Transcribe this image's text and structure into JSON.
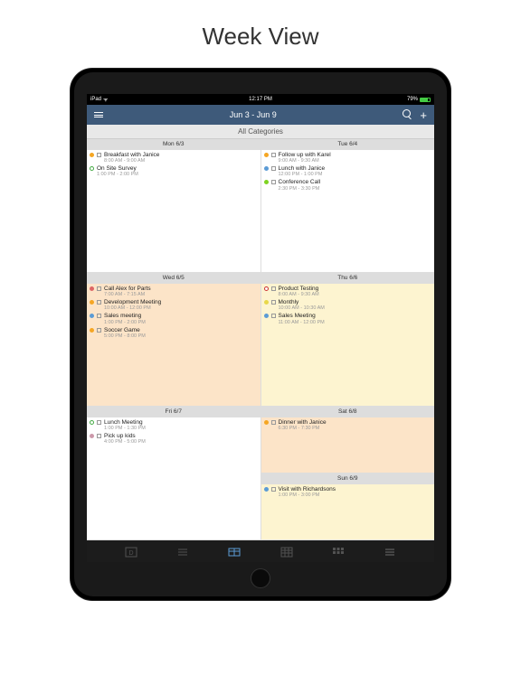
{
  "title": "Week View",
  "statusbar": {
    "device": "iPad",
    "time": "12:17 PM",
    "battery": "79%"
  },
  "nav": {
    "title": "Jun 3 - Jun 9"
  },
  "categories": "All Categories",
  "days": {
    "mon": {
      "label": "Mon 6/3",
      "bg": "white",
      "events": [
        {
          "dot": "#f5a623",
          "title": "Breakfast with Janice",
          "time": "8:00 AM - 9:00 AM",
          "chk": true
        },
        {
          "dot": "#4a4",
          "title": "On Site Survey",
          "time": "1:00 PM - 2:00 PM",
          "chk": false,
          "ring": true
        }
      ]
    },
    "tue": {
      "label": "Tue 6/4",
      "bg": "white",
      "events": [
        {
          "dot": "#f5a623",
          "title": "Follow up with Karel",
          "time": "9:00 AM - 9:30 AM",
          "chk": true
        },
        {
          "dot": "#5b9bd5",
          "title": "Lunch with Janice",
          "time": "12:00 PM - 1:00 PM",
          "chk": true
        },
        {
          "dot": "#7ed321",
          "title": "Conference Call",
          "time": "2:30 PM - 3:30 PM",
          "chk": true
        }
      ]
    },
    "wed": {
      "label": "Wed 6/5",
      "bg": "orange",
      "events": [
        {
          "dot": "#d66",
          "title": "Call Alex for Parts",
          "time": "7:00 AM - 7:15 AM",
          "chk": true
        },
        {
          "dot": "#f5a623",
          "title": "Development Meeting",
          "time": "10:00 AM - 12:00 PM",
          "chk": true
        },
        {
          "dot": "#5b9bd5",
          "title": "Sales meeting",
          "time": "1:00 PM - 2:00 PM",
          "chk": true
        },
        {
          "dot": "#f5a623",
          "title": "Soccer Game",
          "time": "5:00 PM - 8:00 PM",
          "chk": true
        }
      ]
    },
    "thu": {
      "label": "Thu 6/6",
      "bg": "yellow",
      "events": [
        {
          "dot": "#c33",
          "title": "Product Testing",
          "time": "8:00 AM - 9:30 AM",
          "chk": true,
          "ring": true
        },
        {
          "dot": "#e8d84a",
          "title": "Monthly",
          "time": "10:00 AM - 10:30 AM",
          "chk": true
        },
        {
          "dot": "#5b9bd5",
          "title": "Sales Meeting",
          "time": "11:00 AM - 12:00 PM",
          "chk": true
        }
      ]
    },
    "fri": {
      "label": "Fri 6/7",
      "bg": "white",
      "events": [
        {
          "dot": "#4a4",
          "title": "Lunch Meeting",
          "time": "1:00 PM - 1:30 PM",
          "chk": true,
          "ring": true
        },
        {
          "dot": "#c9a",
          "title": "Pick up kids",
          "time": "4:00 PM - 5:00 PM",
          "chk": true
        }
      ]
    },
    "sat": {
      "label": "Sat 6/8",
      "bg": "orange",
      "events": [
        {
          "dot": "#f5a623",
          "title": "Dinner with Janice",
          "time": "6:30 PM - 7:30 PM",
          "chk": true
        }
      ]
    },
    "sun": {
      "label": "Sun 6/9",
      "bg": "yellow",
      "events": [
        {
          "dot": "#5b9bd5",
          "title": "Visit with Richardsons",
          "time": "1:00 PM - 3:00 PM",
          "chk": true
        }
      ]
    }
  }
}
